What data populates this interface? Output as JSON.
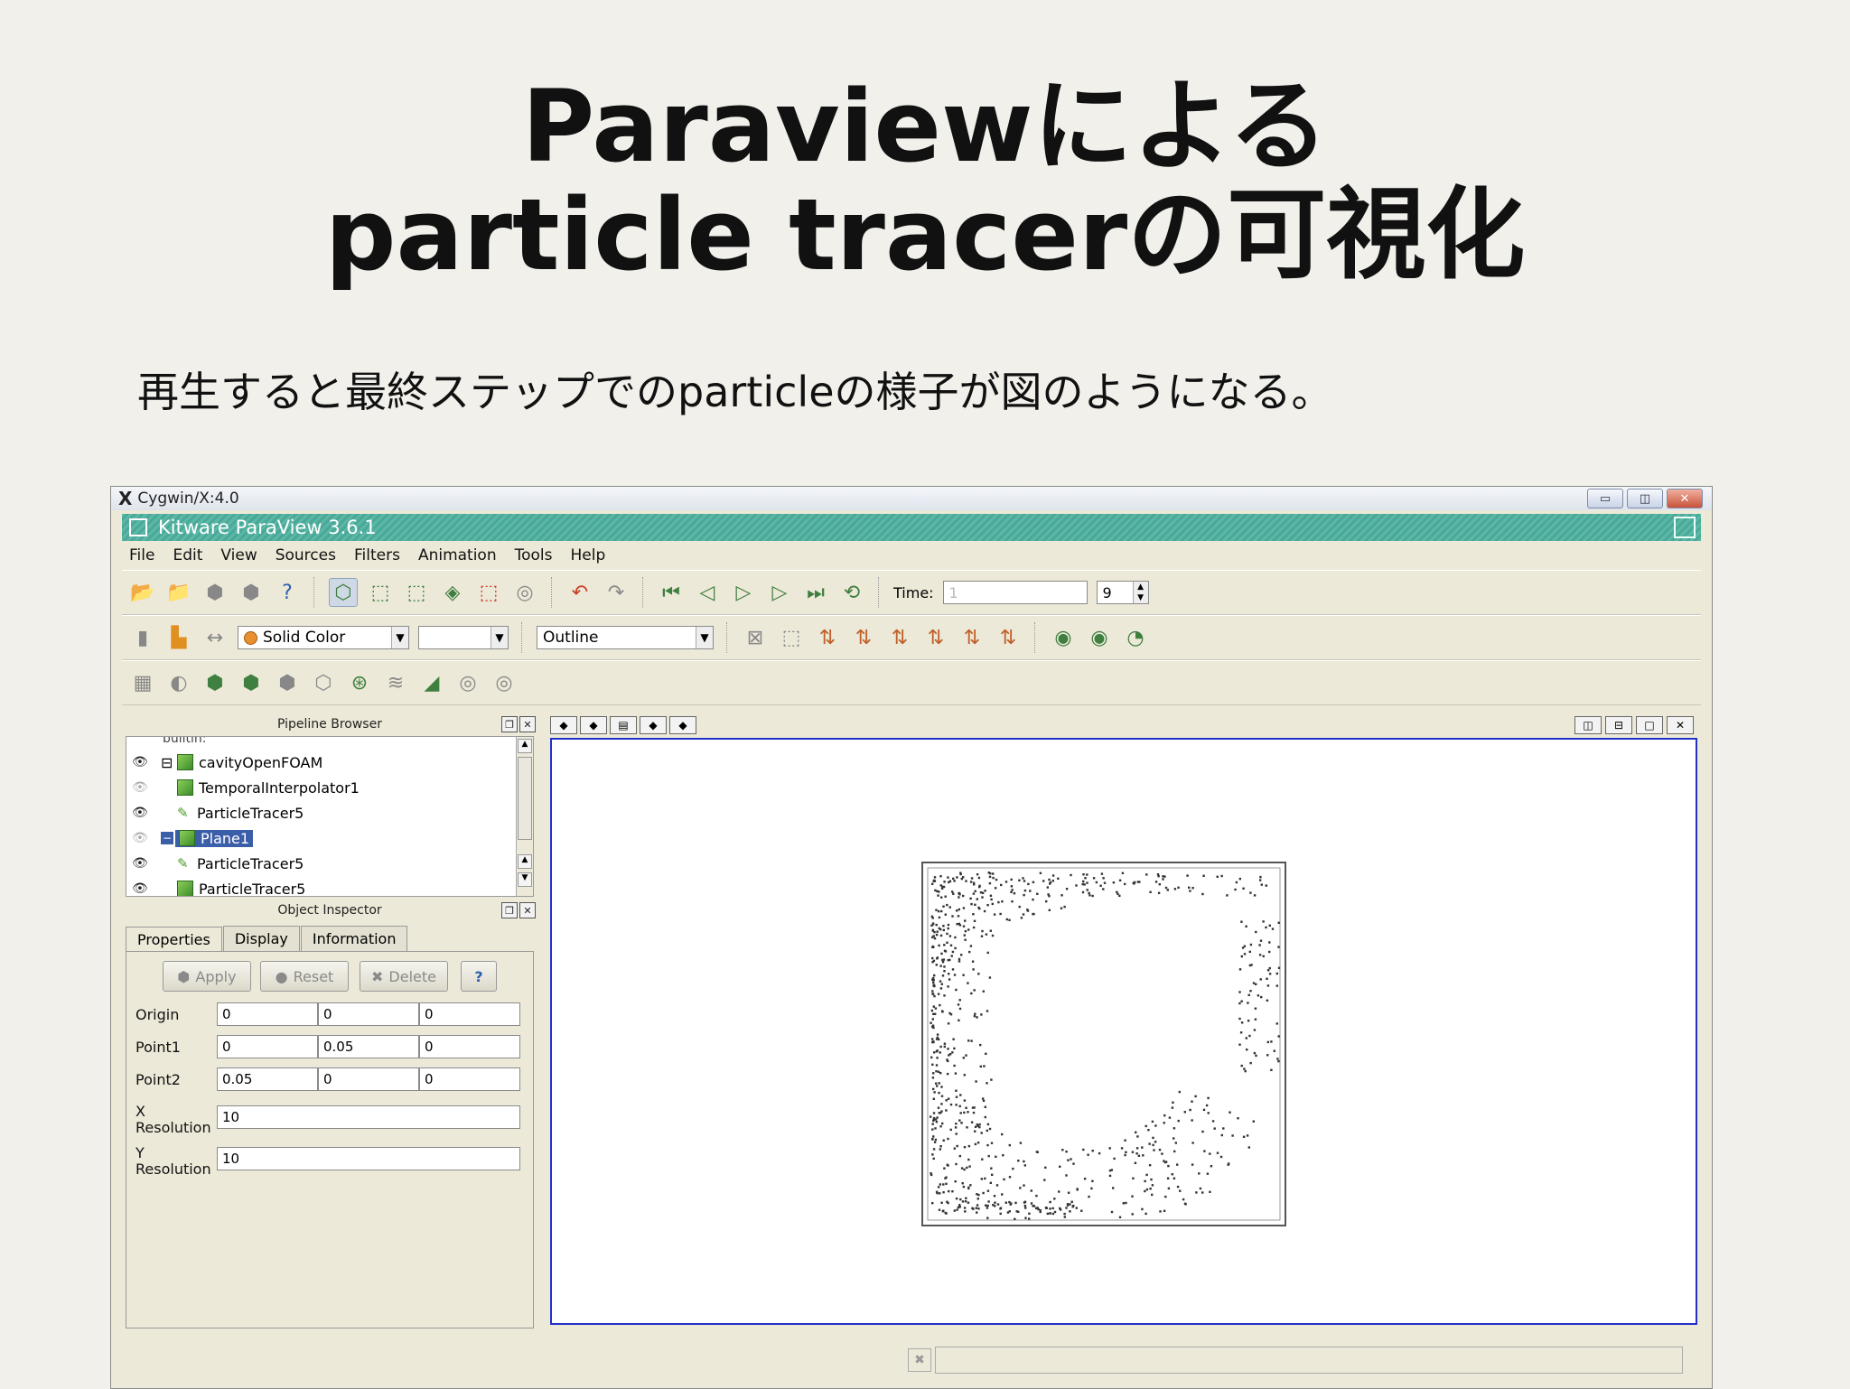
{
  "slide": {
    "title_line1": "Paraviewによる",
    "title_line2": "particle tracerの可視化",
    "subtitle": "再生すると最終ステップでのparticleの様子が図のようになる。"
  },
  "xwindow": {
    "title": "Cygwin/X:4.0"
  },
  "app": {
    "title": "Kitware ParaView 3.6.1"
  },
  "menu": [
    "File",
    "Edit",
    "View",
    "Sources",
    "Filters",
    "Animation",
    "Tools",
    "Help"
  ],
  "toolbar": {
    "time_label": "Time:",
    "time_value": "1",
    "time_step": "9",
    "color_mode": "Solid Color",
    "representation": "Outline"
  },
  "pipeline": {
    "title": "Pipeline Browser",
    "root": "builtin:",
    "items": [
      "cavityOpenFOAM",
      "TemporalInterpolator1",
      "ParticleTracer5",
      "Plane1",
      "ParticleTracer5",
      "ParticleTracer5"
    ]
  },
  "inspector": {
    "title": "Object Inspector",
    "tabs": [
      "Properties",
      "Display",
      "Information"
    ],
    "buttons": {
      "apply": "Apply",
      "reset": "Reset",
      "delete": "Delete",
      "help": "?"
    },
    "origin": {
      "label": "Origin",
      "values": [
        "0",
        "0",
        "0"
      ]
    },
    "point1": {
      "label": "Point1",
      "values": [
        "0",
        "0.05",
        "0"
      ]
    },
    "point2": {
      "label": "Point2",
      "values": [
        "0.05",
        "0",
        "0"
      ]
    },
    "xres": {
      "label_a": "X",
      "label_b": "Resolution",
      "value": "10"
    },
    "yres": {
      "label_a": "Y",
      "label_b": "Resolution",
      "value": "10"
    }
  },
  "colors": {
    "accent": "#5bb8a8",
    "view_border": "#2230c8",
    "selection": "#3b5ea8"
  }
}
